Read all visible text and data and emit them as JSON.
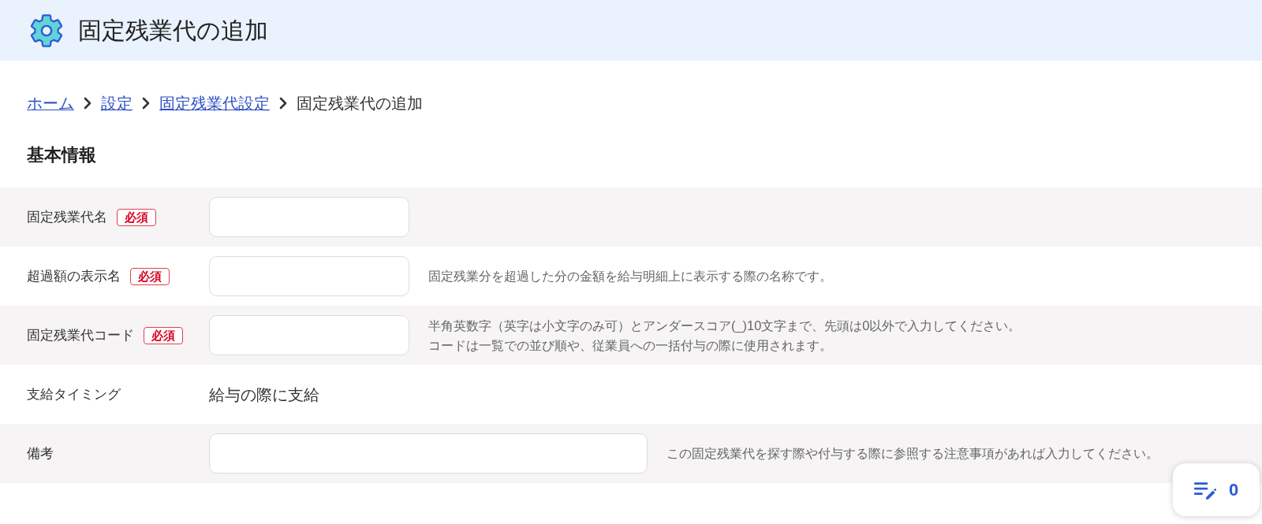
{
  "header": {
    "title": "固定残業代の追加"
  },
  "breadcrumb": [
    {
      "label": "ホーム",
      "kind": "link"
    },
    {
      "label": "設定",
      "kind": "link"
    },
    {
      "label": "固定残業代設定",
      "kind": "link"
    },
    {
      "label": "固定残業代の追加",
      "kind": "current"
    }
  ],
  "section": {
    "title": "基本情報"
  },
  "fields": [
    {
      "label": "固定残業代名",
      "badge": "必須",
      "kind": "input"
    },
    {
      "label": "超過額の表示名",
      "badge": "必須",
      "kind": "input",
      "help": [
        "固定残業分を超過した分の金額を給与明細上に表示する際の名称です。"
      ]
    },
    {
      "label": "固定残業代コード",
      "badge": "必須",
      "kind": "input",
      "help": [
        "半角英数字（英字は小文字のみ可）とアンダースコア(_)10文字まで、先頭は0以外で入力してください。",
        "コードは一覧での並び順や、従業員への一括付与の際に使用されます。"
      ]
    },
    {
      "label": "支給タイミング",
      "kind": "text",
      "value": "給与の際に支給"
    },
    {
      "label": "備考",
      "kind": "wide_input",
      "help": [
        "この固定残業代を探す際や付与する際に参照する注意事項があれば入力してください。"
      ]
    }
  ],
  "counter_button": {
    "count": "0"
  }
}
